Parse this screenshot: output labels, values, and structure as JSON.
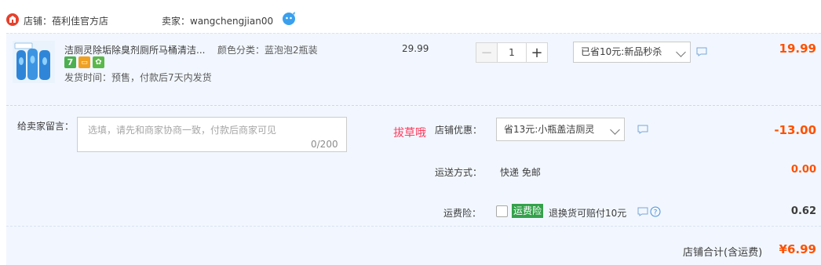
{
  "header": {
    "shop_label": "店铺：蓓利佳官方店",
    "seller_label": "卖家：wangchengjian00"
  },
  "item": {
    "title": "洁厕灵除垢除臭剂厕所马桶清洁...",
    "sku": "颜色分类：蓝泡泡2瓶装",
    "ship_time": "发货时间：预售，付款后7天内发货",
    "unit_price": "29.99",
    "quantity": "1",
    "minus": "−",
    "plus": "+",
    "promo": "已省10元:新品秒杀",
    "total": "19.99",
    "badges": [
      {
        "text": "7",
        "color": "#4caf50"
      },
      {
        "text": "▭",
        "color": "#f0a020"
      },
      {
        "text": "✿",
        "color": "#5bb84a"
      }
    ]
  },
  "order": {
    "message_label": "给卖家留言：",
    "message_placeholder": "选填，请先和商家协商一致，付款后商家可见",
    "message_count": "0/200",
    "grass_text": "拔草哦",
    "coupon_label": "店铺优惠：",
    "coupon_select": "省13元:小瓶盖洁厕灵",
    "discount": "-13.00",
    "shipping_label": "运送方式：",
    "shipping_method": "快递 免邮",
    "shipping_fee": "0.00",
    "insurance_label": "运费险：",
    "insurance_badge": "运费险",
    "insurance_text": "退换货可赔付10元",
    "insurance_fee": "0.62",
    "total_label": "店铺合计(含运费)",
    "total_value": "¥6.99"
  },
  "colors": {
    "accent": "#ff5000",
    "row_bg": "#f2f7ff",
    "insurance_green": "#33a14a"
  },
  "icons": [
    "shop-icon",
    "wangwang-icon",
    "chat-icon",
    "help-icon",
    "chevron-down-icon",
    "product-thumbnail"
  ]
}
